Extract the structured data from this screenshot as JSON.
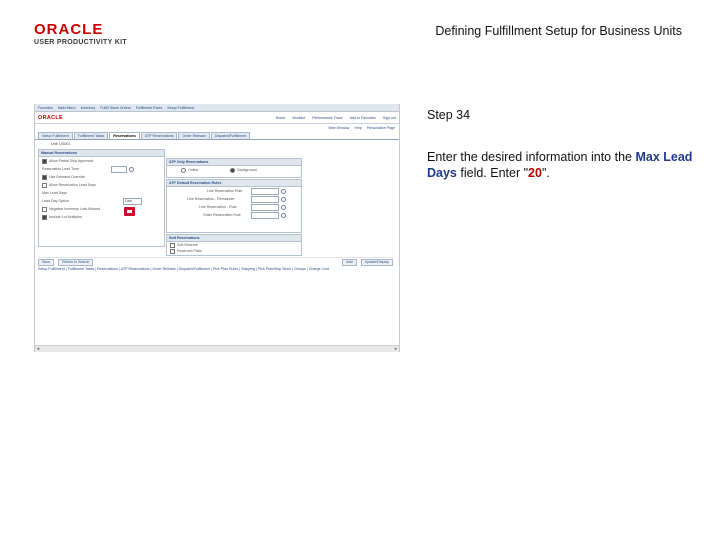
{
  "header": {
    "logo_brand": "ORACLE",
    "logo_sub": "USER PRODUCTIVITY KIT",
    "title": "Defining Fulfillment Setup for Business Units"
  },
  "step": {
    "title": "Step 34",
    "text_before": "Enter the desired information into the ",
    "field": "Max Lead Days",
    "text_mid": " field. Enter \"",
    "value": "20",
    "text_after": "\"."
  },
  "app": {
    "nav": [
      "Favorites",
      "Main Menu",
      "Inventory",
      "Fulfill Stock Orders",
      "Fulfillment Rules",
      "Setup Fulfillment"
    ],
    "brand": "ORACLE",
    "links": [
      "Home",
      "Worklist",
      "Performance Trace",
      "Add to Favorites",
      "Sign out"
    ],
    "sublinks": [
      "New Window",
      "Help",
      "Personalize Page"
    ],
    "tabs": [
      "Setup Fulfillment",
      "Fulfillment Tasks",
      "Reservations",
      "ATP Reservations",
      "Order Release",
      "Dispatch/Fulfillment"
    ],
    "active_tab": 2,
    "unit": "Unit: US001",
    "left_panel": {
      "title": "Manual Reservations",
      "rows": [
        "Allow Partial Ship Approved",
        "Reservation Lead Time",
        "Use Demand Override",
        "Allow Reservation Lead Days",
        "Max Lead Days",
        "Lead Day Option"
      ],
      "lead_day_option": "Date",
      "neg_rows": [
        "Negative Inventory Lots Allowed",
        "Include Lot Multiples"
      ]
    },
    "right_top": {
      "title": "ATP Only Reservations",
      "opt1": "Online",
      "opt2": "Background"
    },
    "right_mid": {
      "title": "ATP Default Reservation Rules",
      "rows": [
        "Line Reservation Rule",
        "Line Reservation - Remainder",
        "Line Reservation - Rule",
        "Order Reservation Rule"
      ]
    },
    "right_bot": {
      "title": "Soft Reservations",
      "rows": [
        "Soft Reserve",
        "Reserved Picks"
      ]
    },
    "buttons_left": [
      "Save",
      "Return to Search"
    ],
    "buttons_right": [
      "Add",
      "Update/Display"
    ],
    "bottom_links": "Setup Fulfillment | Fulfillment Tasks | Reservations | ATP Reservations | Order Release | Dispatch/Fulfillment | Pick Plan Rules | Shipping | Pick Plan/Ship Stock | Groups | Charge Cost"
  }
}
